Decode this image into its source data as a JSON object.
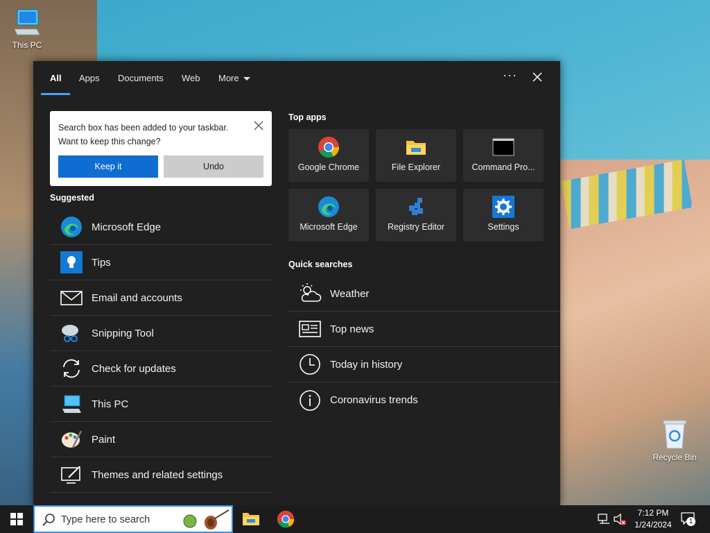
{
  "desktop": {
    "this_pc_label": "This PC",
    "recycle_bin_label": "Recycle Bin"
  },
  "tabs": [
    {
      "label": "All",
      "active": true
    },
    {
      "label": "Apps"
    },
    {
      "label": "Documents"
    },
    {
      "label": "Web"
    },
    {
      "label": "More"
    }
  ],
  "more_options_label": "···",
  "toast": {
    "message_line1": "Search box has been added to your taskbar.",
    "message_line2": "Want to keep this change?",
    "keep_label": "Keep it",
    "undo_label": "Undo"
  },
  "suggested": {
    "title": "Suggested",
    "items": [
      {
        "label": "Microsoft Edge",
        "icon": "edge-icon"
      },
      {
        "label": "Tips",
        "icon": "tips-icon"
      },
      {
        "label": "Email and accounts",
        "icon": "mail-icon"
      },
      {
        "label": "Snipping Tool",
        "icon": "snipping-tool-icon"
      },
      {
        "label": "Check for updates",
        "icon": "refresh-icon"
      },
      {
        "label": "This PC",
        "icon": "this-pc-icon"
      },
      {
        "label": "Paint",
        "icon": "paint-icon"
      },
      {
        "label": "Themes and related settings",
        "icon": "themes-icon"
      }
    ]
  },
  "top_apps": {
    "title": "Top apps",
    "items": [
      {
        "label": "Google Chrome",
        "icon": "chrome-icon"
      },
      {
        "label": "File Explorer",
        "icon": "folder-icon"
      },
      {
        "label": "Command Pro...",
        "icon": "cmd-icon"
      },
      {
        "label": "Microsoft Edge",
        "icon": "edge-icon"
      },
      {
        "label": "Registry Editor",
        "icon": "registry-icon"
      },
      {
        "label": "Settings",
        "icon": "gear-icon"
      }
    ]
  },
  "quick_searches": {
    "title": "Quick searches",
    "items": [
      {
        "label": "Weather",
        "icon": "weather-icon"
      },
      {
        "label": "Top news",
        "icon": "news-icon"
      },
      {
        "label": "Today in history",
        "icon": "clock-icon"
      },
      {
        "label": "Coronavirus trends",
        "icon": "info-icon"
      }
    ]
  },
  "taskbar": {
    "search_placeholder": "Type here to search",
    "time": "7:12 PM",
    "date": "1/24/2024",
    "notification_count": "1"
  },
  "colors": {
    "accent": "#0f6cd1",
    "panel_bg": "#202020",
    "tile_bg": "#2d2d2d"
  }
}
